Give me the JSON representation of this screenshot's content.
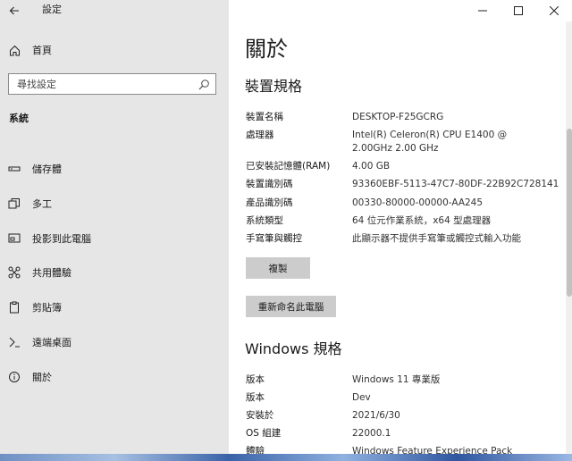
{
  "window": {
    "title": "設定"
  },
  "sidebar": {
    "home_label": "首頁",
    "search_placeholder": "尋找設定",
    "section_label": "系統",
    "items": [
      {
        "label": "儲存體",
        "icon": "storage-icon"
      },
      {
        "label": "多工",
        "icon": "multitasking-icon"
      },
      {
        "label": "投影到此電腦",
        "icon": "project-icon"
      },
      {
        "label": "共用體驗",
        "icon": "shared-experiences-icon"
      },
      {
        "label": "剪貼簿",
        "icon": "clipboard-icon"
      },
      {
        "label": "遠端桌面",
        "icon": "remote-desktop-icon"
      },
      {
        "label": "關於",
        "icon": "info-icon"
      }
    ]
  },
  "main": {
    "title": "關於",
    "device_specs": {
      "heading": "裝置規格",
      "rows": [
        {
          "label": "裝置名稱",
          "value": "DESKTOP-F25GCRG"
        },
        {
          "label": "處理器",
          "value": "Intel(R) Celeron(R) CPU        E1400  @",
          "value2": "2.00GHz   2.00 GHz"
        },
        {
          "label": "已安裝記憶體(RAM)",
          "value": "4.00 GB"
        },
        {
          "label": "裝置識別碼",
          "value": "93360EBF-5113-47C7-80DF-22B92C728141"
        },
        {
          "label": "產品識別碼",
          "value": "00330-80000-00000-AA245"
        },
        {
          "label": "系統類型",
          "value": "64 位元作業系統，x64 型處理器"
        },
        {
          "label": "手寫筆與觸控",
          "value": "此顯示器不提供手寫筆或觸控式輸入功能"
        }
      ],
      "copy_button": "複製",
      "rename_button": "重新命名此電腦"
    },
    "windows_specs": {
      "heading": "Windows 規格",
      "rows": [
        {
          "label": "版本",
          "value": "Windows 11 專業版"
        },
        {
          "label": "版本",
          "value": "Dev"
        },
        {
          "label": "安裝於",
          "value": "2021/6/30"
        },
        {
          "label": "OS 組建",
          "value": "22000.1"
        },
        {
          "label": "體驗",
          "value": "Windows Feature Experience Pack"
        }
      ]
    }
  }
}
